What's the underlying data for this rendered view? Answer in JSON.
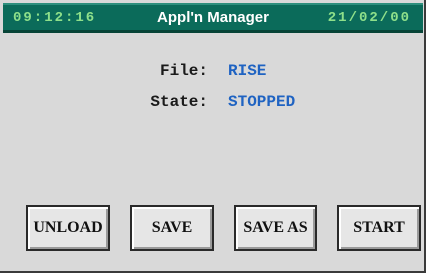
{
  "header": {
    "time": "09:12:16",
    "title": "Appl'n Manager",
    "date": "21/02/00"
  },
  "info": {
    "file_label": "File:",
    "file_value": "RISE",
    "state_label": "State:",
    "state_value": "STOPPED"
  },
  "buttons": {
    "unload": "UNLOAD",
    "save": "SAVE",
    "save_as": "SAVE AS",
    "start": "START"
  },
  "colors": {
    "titlebar": "#0b6b5a",
    "clock_text": "#8ee08a",
    "value_text": "#1f63c2",
    "background": "#d9d9d9"
  }
}
